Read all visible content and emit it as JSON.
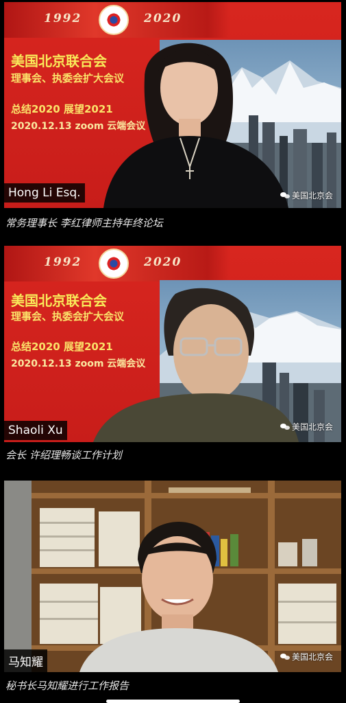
{
  "slide": {
    "year_start": "1992",
    "year_end": "2020",
    "org_name": "美国北京联合会",
    "meeting": "理事会、执委会扩大会议",
    "theme": "总结2020 展望2021",
    "date_line": "2020.12.13 zoom 云端会议"
  },
  "watermark": {
    "text": "美国北京会",
    "icon": "wechat-icon"
  },
  "frames": [
    {
      "name_tag": "Hong Li Esq.",
      "caption": "常务理事长 李红律师主持年终论坛"
    },
    {
      "name_tag": "Shaoli Xu",
      "caption": "会长 许绍理畅谈工作计划"
    },
    {
      "name_tag": "马知耀",
      "caption": "秘书长马知耀进行工作报告"
    }
  ]
}
